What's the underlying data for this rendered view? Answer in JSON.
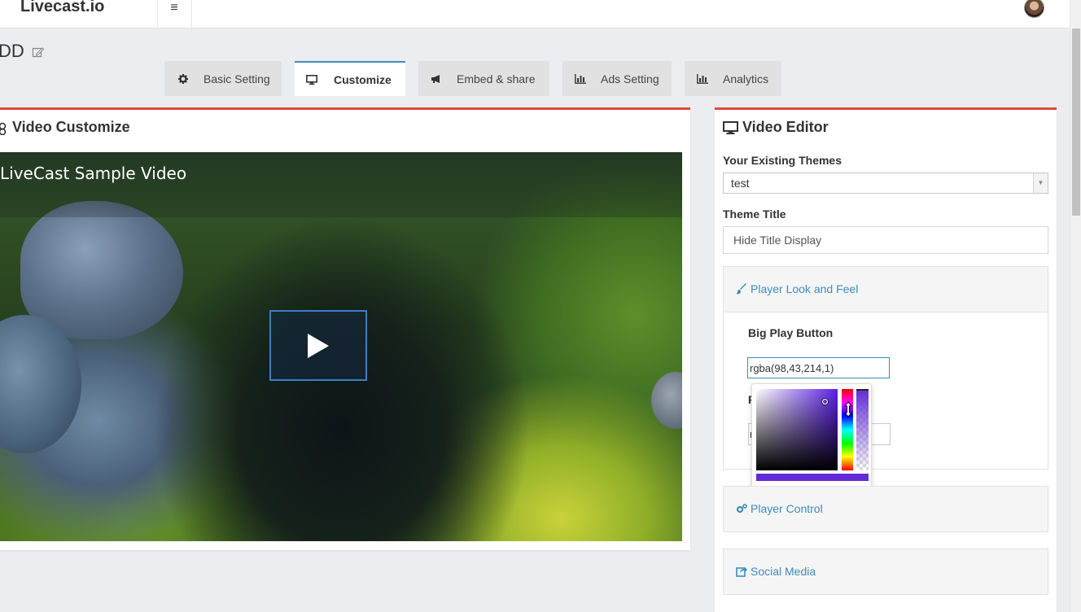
{
  "app": {
    "brand": "Livecast.io"
  },
  "page": {
    "title": "DD"
  },
  "tabs": [
    {
      "label": "Basic Setting",
      "icon": "gear-icon"
    },
    {
      "label": "Customize",
      "icon": "monitor-icon"
    },
    {
      "label": "Embed & share",
      "icon": "bullhorn-icon"
    },
    {
      "label": "Ads Setting",
      "icon": "bar-chart-icon"
    },
    {
      "label": "Analytics",
      "icon": "bar-chart-icon"
    }
  ],
  "video_panel": {
    "title": "Video Customize",
    "video_title": "LiveCast Sample Video"
  },
  "editor": {
    "title": "Video Editor",
    "themes_label": "Your Existing Themes",
    "theme_selected": "test",
    "theme_title_label": "Theme Title",
    "theme_title_value": "Hide Title Display",
    "sections": {
      "look_and_feel": "Player Look and Feel",
      "player_control": "Player Control",
      "social_media": "Social Media"
    },
    "big_play_button_label": "Big Play Button",
    "big_play_button_value": "rgba(98,43,214,1)",
    "hidden_label_fragment": "P",
    "hidden_input_fragment": "r"
  },
  "color_picker": {
    "color": "rgba(98,43,214,1)",
    "accent": "#3c8dbc",
    "panel_border": "#dd4b39"
  }
}
